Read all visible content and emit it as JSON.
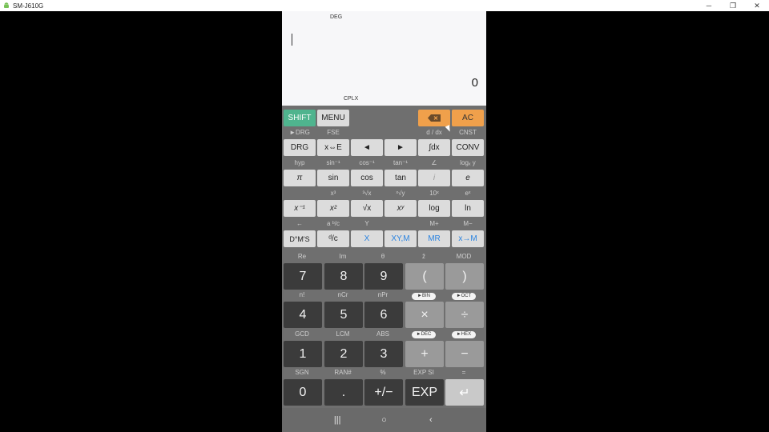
{
  "window": {
    "title": "SM-J610G",
    "minimize": "─",
    "restore": "❐",
    "close": "✕"
  },
  "display": {
    "angle_mode": "DEG",
    "result": "0",
    "mode": "CPLX"
  },
  "top_keys": {
    "shift": "SHIFT",
    "menu": "MENU",
    "ac": "AC"
  },
  "row1": {
    "labels": [
      "►DRG",
      "FSE",
      "",
      "",
      "d / dx",
      "CNST"
    ],
    "keys": [
      "DRG",
      "x⇔E",
      "◄",
      "►",
      "∫dx",
      "CONV"
    ]
  },
  "row2": {
    "labels": [
      "hyp",
      "sin⁻¹",
      "cos⁻¹",
      "tan⁻¹",
      "∠",
      "logₓ y"
    ],
    "keys": [
      "π",
      "sin",
      "cos",
      "tan",
      "i",
      "e"
    ]
  },
  "row3": {
    "labels": [
      "",
      "x³",
      "³√x",
      "ˣ√y",
      "10ˣ",
      "eˣ"
    ],
    "keys": [
      "x⁻¹",
      "x²",
      "√x",
      "xʸ",
      "log",
      "ln"
    ]
  },
  "row4": {
    "labels": [
      "←",
      "a ᵇ/c",
      "Y",
      "",
      "M+",
      "M−"
    ],
    "keys": [
      "D°M'S",
      "ᵈ/c",
      "X",
      "XY,M",
      "MR",
      "x→M"
    ]
  },
  "num_rows": [
    {
      "labels": [
        "Re",
        "Im",
        "θ",
        "z̄",
        "MOD"
      ],
      "keys": [
        "7",
        "8",
        "9",
        "(",
        ")"
      ]
    },
    {
      "labels": [
        "n!",
        "nCr",
        "nPr",
        "►BIN",
        "►OCT"
      ],
      "keys": [
        "4",
        "5",
        "6",
        "×",
        "÷"
      ]
    },
    {
      "labels": [
        "GCD",
        "LCM",
        "ABS",
        "►DEC",
        "►HEX"
      ],
      "keys": [
        "1",
        "2",
        "3",
        "+",
        "−"
      ]
    },
    {
      "labels": [
        "SGN",
        "RAN#",
        "%",
        "EXP SI",
        "="
      ],
      "keys": [
        "0",
        ".",
        "+/−",
        "EXP",
        "↵"
      ]
    }
  ],
  "navbar": {
    "recents": "|||",
    "home": "○",
    "back": "‹"
  }
}
